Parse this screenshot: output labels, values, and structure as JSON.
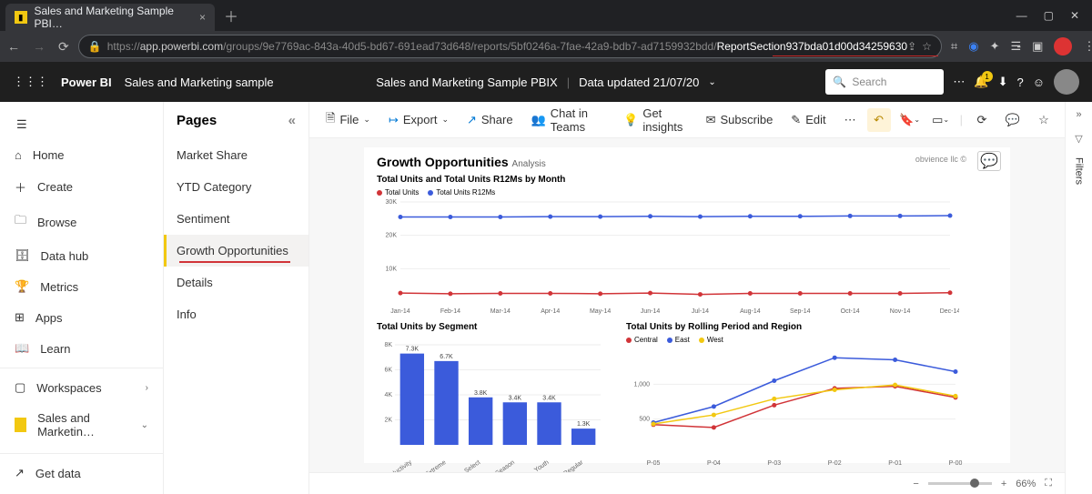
{
  "browser": {
    "tab_title": "Sales and Marketing Sample PBI…",
    "url_prefix": "https://",
    "url_host": "app.powerbi.com",
    "url_path": "/groups/9e7769ac-843a-40d5-bd67-691ead73d648/reports/5bf0246a-7fae-42a9-bdb7-ad7159932bdd/",
    "url_highlight": "ReportSection937bda01d00d34259630"
  },
  "pbi": {
    "brand": "Power BI",
    "workspace": "Sales and Marketing sample",
    "center_title": "Sales and Marketing Sample PBIX",
    "data_updated_label": "Data updated 21/07/20",
    "search_placeholder": "Search",
    "bell_count": "1"
  },
  "left_rail": [
    {
      "icon": "home",
      "label": "Home"
    },
    {
      "icon": "plus",
      "label": "Create"
    },
    {
      "icon": "browse",
      "label": "Browse"
    },
    {
      "icon": "datahub",
      "label": "Data hub"
    },
    {
      "icon": "metrics",
      "label": "Metrics"
    },
    {
      "icon": "apps",
      "label": "Apps"
    },
    {
      "icon": "learn",
      "label": "Learn"
    }
  ],
  "left_rail_bottom": [
    {
      "icon": "workspaces",
      "label": "Workspaces",
      "chev": "›"
    },
    {
      "icon": "ws",
      "label": "Sales and Marketin…",
      "chev": "⌄"
    }
  ],
  "get_data": "Get data",
  "pages_title": "Pages",
  "pages": [
    {
      "label": "Market Share"
    },
    {
      "label": "YTD Category"
    },
    {
      "label": "Sentiment"
    },
    {
      "label": "Growth Opportunities",
      "active": true,
      "underline": true
    },
    {
      "label": "Details"
    },
    {
      "label": "Info"
    }
  ],
  "toolbar": {
    "file": "File",
    "export": "Export",
    "share": "Share",
    "chat": "Chat in Teams",
    "insights": "Get insights",
    "subscribe": "Subscribe",
    "edit": "Edit"
  },
  "report": {
    "title": "Growth Opportunities",
    "subtitle": "Analysis",
    "copyright": "obvience llc ©"
  },
  "zoom": "66%",
  "filters_label": "Filters",
  "chart_data": [
    {
      "type": "line",
      "title": "Total Units and Total Units R12Ms by Month",
      "categories": [
        "Jan-14",
        "Feb-14",
        "Mar-14",
        "Apr-14",
        "May-14",
        "Jun-14",
        "Jul-14",
        "Aug-14",
        "Sep-14",
        "Oct-14",
        "Nov-14",
        "Dec-14"
      ],
      "series": [
        {
          "name": "Total Units",
          "color": "#d13438",
          "values": [
            2700,
            2500,
            2600,
            2600,
            2500,
            2700,
            2300,
            2600,
            2600,
            2600,
            2600,
            2800
          ]
        },
        {
          "name": "Total Units R12Ms",
          "color": "#3b5bdb",
          "values": [
            25500,
            25500,
            25500,
            25600,
            25600,
            25700,
            25600,
            25700,
            25700,
            25800,
            25800,
            25900
          ]
        }
      ],
      "ylabel": "",
      "ylim": [
        0,
        30000
      ],
      "yticks": [
        10000,
        20000,
        30000
      ],
      "ytick_labels": [
        "10K",
        "20K",
        "30K"
      ]
    },
    {
      "type": "bar",
      "title": "Total Units by Segment",
      "categories": [
        "Productivity",
        "Extreme",
        "Select",
        "All Season",
        "Youth",
        "Regular"
      ],
      "values": [
        7300,
        6700,
        3800,
        3400,
        3400,
        1300
      ],
      "value_labels": [
        "7.3K",
        "6.7K",
        "3.8K",
        "3.4K",
        "3.4K",
        "1.3K"
      ],
      "ylim": [
        0,
        8000
      ],
      "yticks": [
        2000,
        4000,
        6000,
        8000
      ],
      "ytick_labels": [
        "2K",
        "4K",
        "6K",
        "8K"
      ],
      "color": "#3b5bdb"
    },
    {
      "type": "line",
      "title": "Total Units by Rolling Period and Region",
      "categories": [
        "P-05",
        "P-04",
        "P-03",
        "P-02",
        "P-01",
        "P-00"
      ],
      "series": [
        {
          "name": "Central",
          "color": "#d13438",
          "values": [
            420,
            380,
            700,
            940,
            970,
            810
          ]
        },
        {
          "name": "East",
          "color": "#3b5bdb",
          "values": [
            450,
            680,
            1050,
            1380,
            1350,
            1180
          ]
        },
        {
          "name": "West",
          "color": "#f2c811",
          "values": [
            430,
            560,
            790,
            920,
            990,
            830
          ]
        }
      ],
      "ylim": [
        0,
        1500
      ],
      "yticks": [
        500,
        1000
      ],
      "ytick_labels": [
        "500",
        "1,000"
      ]
    }
  ]
}
